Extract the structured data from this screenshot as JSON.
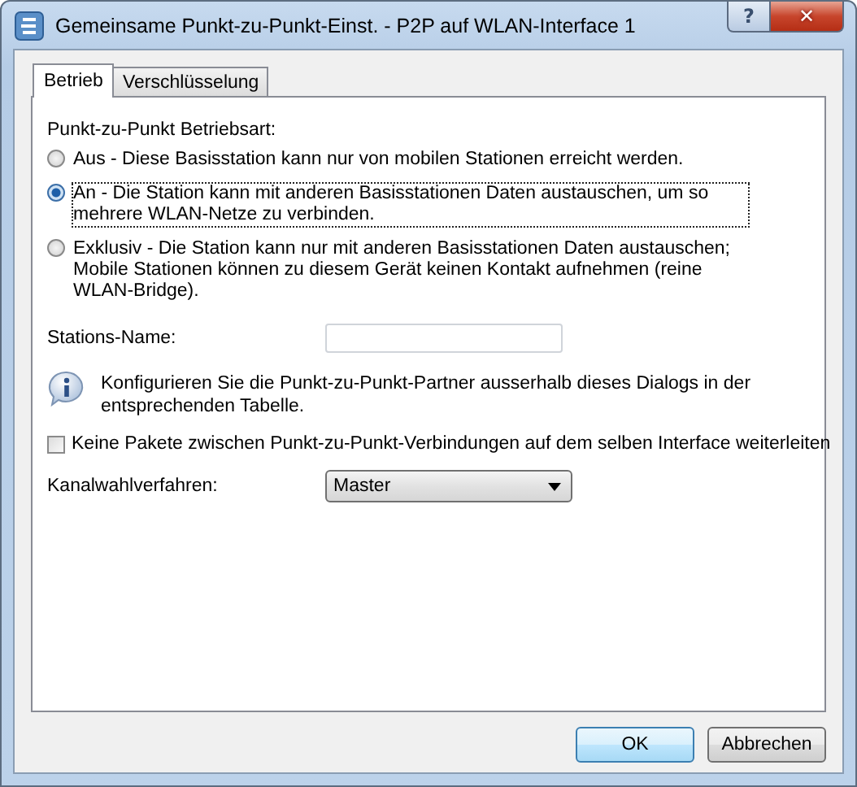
{
  "window": {
    "title": "Gemeinsame Punkt-zu-Punkt-Einst. - P2P auf WLAN-Interface 1",
    "help_button": "?",
    "close_button": "✕"
  },
  "tabs": [
    {
      "label": "Betrieb",
      "selected": true
    },
    {
      "label": "Verschlüsselung",
      "selected": false
    }
  ],
  "mode_group": {
    "label": "Punkt-zu-Punkt Betriebsart:",
    "options": [
      {
        "label": "Aus - Diese Basisstation kann nur von mobilen Stationen erreicht werden.",
        "selected": false,
        "focused": false
      },
      {
        "label": "An - Die Station kann mit anderen Basisstationen Daten austauschen, um so mehrere WLAN-Netze zu verbinden.",
        "selected": true,
        "focused": true
      },
      {
        "label": "Exklusiv - Die Station kann nur mit anderen Basisstationen Daten austauschen; Mobile Stationen können zu diesem Gerät keinen Kontakt aufnehmen (reine WLAN-Bridge).",
        "selected": false,
        "focused": false
      }
    ]
  },
  "station_name": {
    "label": "Stations-Name:"
  },
  "info": "Konfigurieren Sie die Punkt-zu-Punkt-Partner ausserhalb dieses Dialogs in der entsprechenden Tabelle.",
  "checkbox": {
    "label": "Keine Pakete zwischen Punkt-zu-Punkt-Verbindungen auf dem selben Interface weiterleiten",
    "checked": false
  },
  "channel": {
    "label": "Kanalwahlverfahren:",
    "value": "Master"
  },
  "buttons": [
    {
      "label": "OK",
      "default": true
    },
    {
      "label": "Abbrechen",
      "default": false
    }
  ]
}
